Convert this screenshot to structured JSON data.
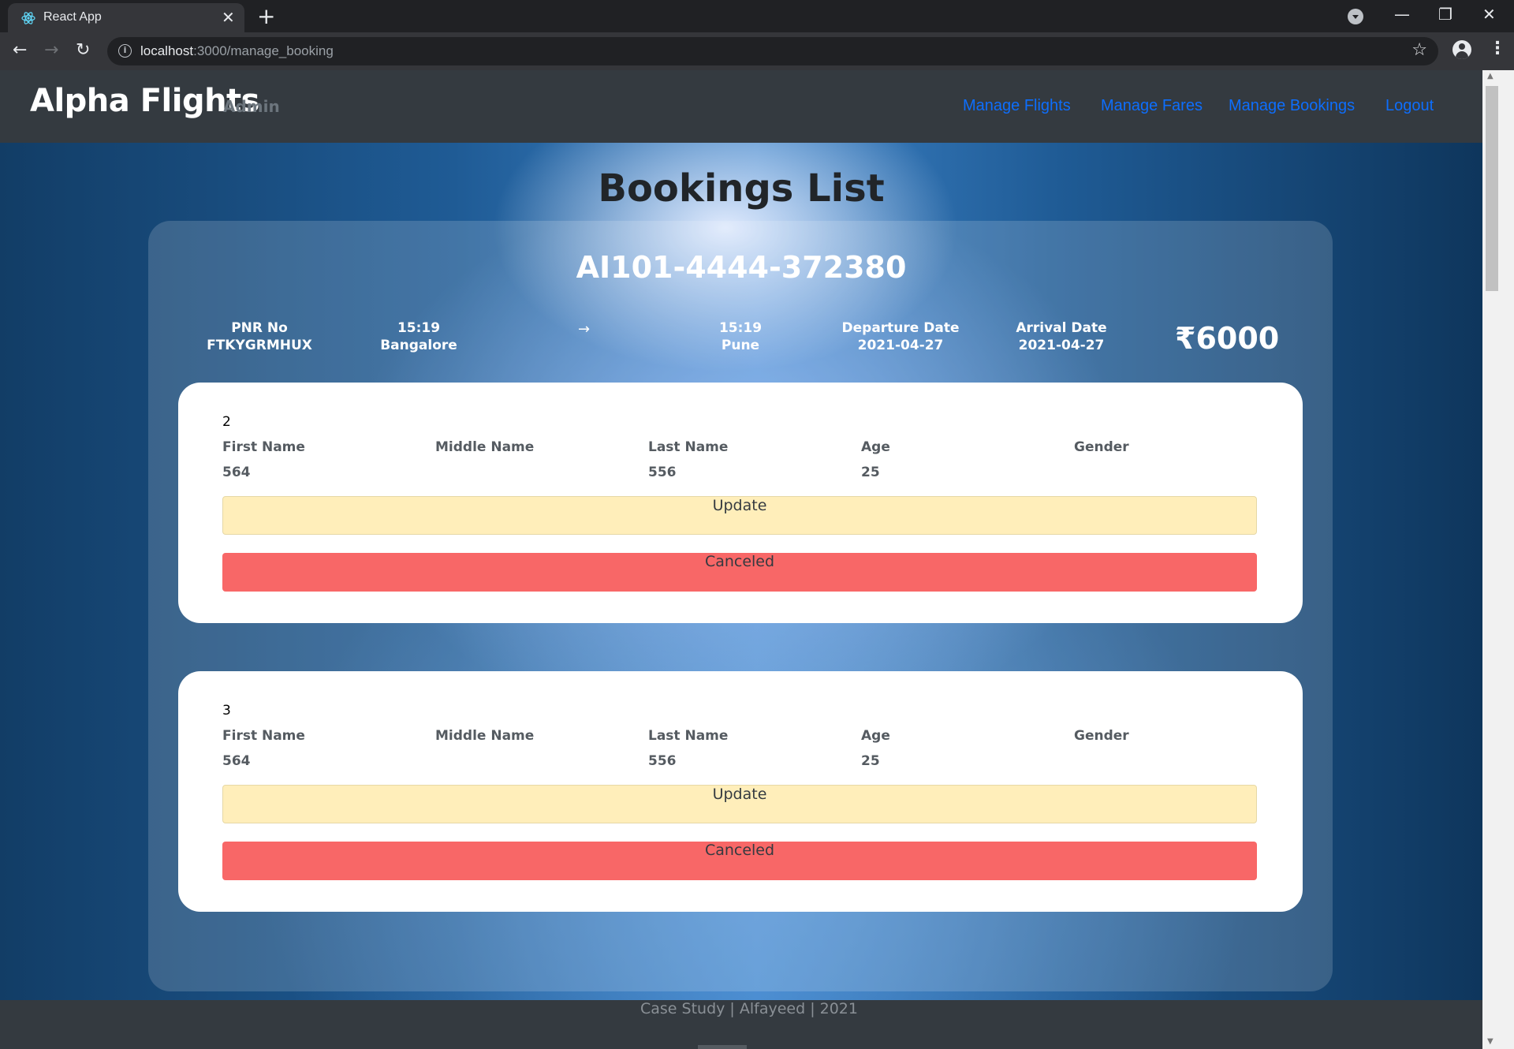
{
  "browser": {
    "tab_title": "React App",
    "url_host": "localhost",
    "url_path": ":3000/manage_booking"
  },
  "navbar": {
    "brand": "Alpha Flights",
    "role": "Admin",
    "links": [
      "Manage Flights",
      "Manage Fares",
      "Manage Bookings",
      "Logout"
    ]
  },
  "page": {
    "title": "Bookings List"
  },
  "booking": {
    "flight_code": "AI101-4444-372380",
    "pnr_label": "PNR No",
    "pnr": "FTKYGRMHUX",
    "departure_time": "15:19",
    "from": "Bangalore",
    "arrow": "→",
    "arrival_time": "15:19",
    "to": "Pune",
    "departure_date_label": "Departure Date",
    "departure_date": "2021-04-27",
    "arrival_date_label": "Arrival Date",
    "arrival_date": "2021-04-27",
    "price": "₹6000"
  },
  "labels": {
    "first_name": "First Name",
    "middle_name": "Middle Name",
    "last_name": "Last Name",
    "age": "Age",
    "gender": "Gender",
    "update": "Update",
    "canceled": "Canceled"
  },
  "passengers": [
    {
      "id": "2",
      "first_name": "564",
      "middle_name": "",
      "last_name": "556",
      "age": "25",
      "gender": ""
    },
    {
      "id": "3",
      "first_name": "564",
      "middle_name": "",
      "last_name": "556",
      "age": "25",
      "gender": ""
    }
  ],
  "footer": {
    "text": "Case Study | Alfayeed | 2021"
  }
}
